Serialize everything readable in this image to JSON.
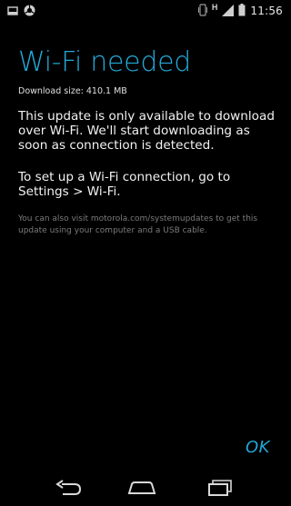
{
  "status_bar": {
    "time": "11:56",
    "network_type": "H",
    "icons": [
      "notification-icon",
      "app-notification-icon",
      "vibrate-icon",
      "signal-icon",
      "battery-icon"
    ]
  },
  "dialog": {
    "title": "Wi-Fi needed",
    "download_size": "Download size: 410.1 MB",
    "message1": "This update is only available to download over Wi-Fi. We'll start downloading as soon as connection is detected.",
    "message2": "To set up a Wi-Fi connection, go to Settings > Wi-Fi.",
    "note": "You can also visit motorola.com/systemupdates to get this update using your computer and a USB cable.",
    "ok_label": "OK"
  },
  "colors": {
    "accent": "#22a9d8",
    "background": "#000000",
    "note_text": "#7b7b7b"
  },
  "nav_bar": {
    "icons": [
      "back-icon",
      "home-icon",
      "recents-icon"
    ]
  }
}
